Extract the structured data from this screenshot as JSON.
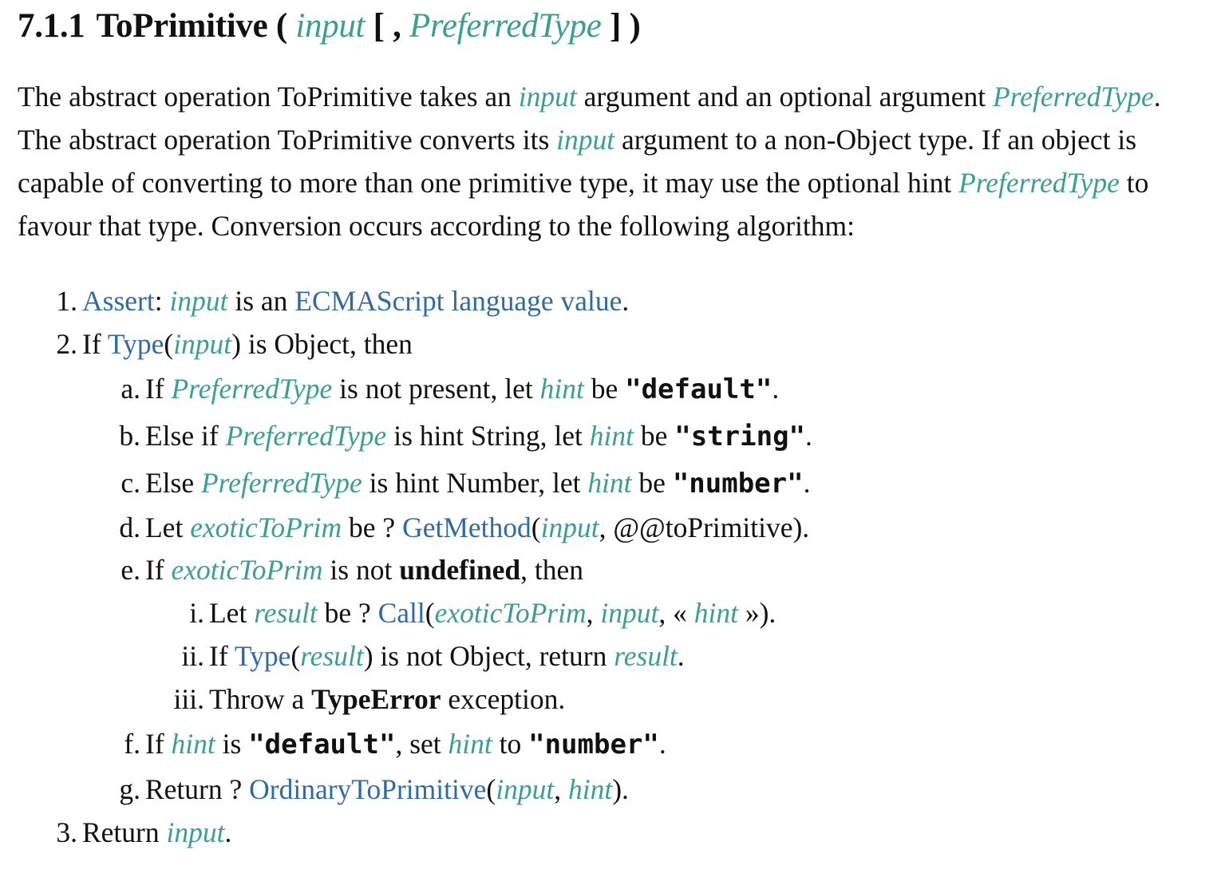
{
  "heading": {
    "number": "7.1.1",
    "name": "ToPrimitive",
    "open": "(",
    "param1": "input",
    "bracket_open": "[ ,",
    "param2": "PreferredType",
    "bracket_close": "] )"
  },
  "intro": {
    "t1": "The abstract operation ToPrimitive takes an ",
    "v1": "input",
    "t2": " argument and an optional argument ",
    "v2": "PreferredType",
    "t3": ". The abstract operation ToPrimitive converts its ",
    "v3": "input",
    "t4": " argument to a non-Object type. If an object is capable of converting to more than one primitive type, it may use the optional hint ",
    "v4": "PreferredType",
    "t5": " to favour that type. Conversion occurs according to the following algorithm:"
  },
  "steps": {
    "s1": {
      "marker": "1.",
      "link1": "Assert",
      "t1": ": ",
      "v1": "input",
      "t2": " is an ",
      "link2": "ECMAScript language value",
      "t3": "."
    },
    "s2": {
      "marker": "2.",
      "t1": "If ",
      "link1": "Type",
      "t2": "(",
      "v1": "input",
      "t3": ") is Object, then"
    },
    "s2a": {
      "marker": "a.",
      "t1": "If ",
      "v1": "PreferredType",
      "t2": " is not present, let ",
      "v2": "hint",
      "t3": " be ",
      "code": "\"default\"",
      "t4": "."
    },
    "s2b": {
      "marker": "b.",
      "t1": "Else if ",
      "v1": "PreferredType",
      "t2": " is hint String, let ",
      "v2": "hint",
      "t3": " be ",
      "code": "\"string\"",
      "t4": "."
    },
    "s2c": {
      "marker": "c.",
      "t1": "Else ",
      "v1": "PreferredType",
      "t2": " is hint Number, let ",
      "v2": "hint",
      "t3": " be ",
      "code": "\"number\"",
      "t4": "."
    },
    "s2d": {
      "marker": "d.",
      "t1": "Let ",
      "v1": "exoticToPrim",
      "t2": " be ? ",
      "link1": "GetMethod",
      "t3": "(",
      "v2": "input",
      "t4": ", @@toPrimitive)."
    },
    "s2e": {
      "marker": "e.",
      "t1": "If ",
      "v1": "exoticToPrim",
      "t2": " is not ",
      "b1": "undefined",
      "t3": ", then"
    },
    "s2ei": {
      "marker": "i.",
      "t1": "Let ",
      "v1": "result",
      "t2": " be ? ",
      "link1": "Call",
      "t3": "(",
      "v2": "exoticToPrim",
      "t4": ", ",
      "v3": "input",
      "t5": ", « ",
      "v4": "hint",
      "t6": " »)."
    },
    "s2eii": {
      "marker": "ii.",
      "t1": "If ",
      "link1": "Type",
      "t2": "(",
      "v1": "result",
      "t3": ") is not Object, return ",
      "v2": "result",
      "t4": "."
    },
    "s2eiii": {
      "marker": "iii.",
      "t1": "Throw a ",
      "b1": "TypeError",
      "t2": " exception."
    },
    "s2f": {
      "marker": "f.",
      "t1": "If ",
      "v1": "hint",
      "t2": " is ",
      "code1": "\"default\"",
      "t3": ", set ",
      "v2": "hint",
      "t4": " to ",
      "code2": "\"number\"",
      "t5": "."
    },
    "s2g": {
      "marker": "g.",
      "t1": "Return ? ",
      "link1": "OrdinaryToPrimitive",
      "t2": "(",
      "v1": "input",
      "t3": ", ",
      "v2": "hint",
      "t4": ")."
    },
    "s3": {
      "marker": "3.",
      "t1": "Return ",
      "v1": "input",
      "t2": "."
    }
  },
  "colors": {
    "variable": "#3a9e93",
    "link": "#2e6aa6",
    "text": "#111111"
  }
}
